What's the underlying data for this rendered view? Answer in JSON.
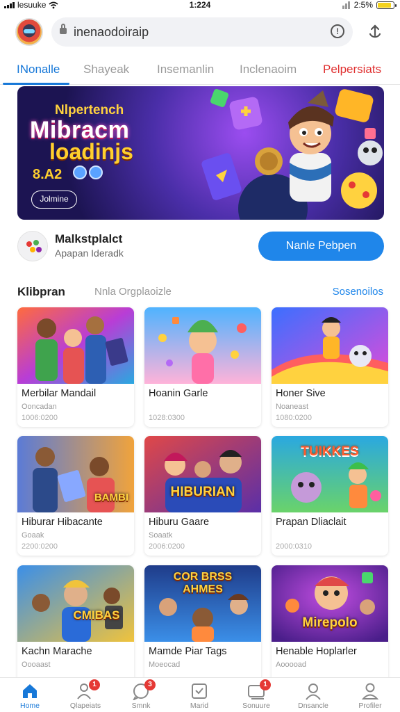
{
  "status_bar": {
    "carrier": "lesuuke",
    "time": "1:224",
    "battery": "2:5%",
    "battery_level": 0.9
  },
  "address_bar": {
    "url": "inenaodoiraip"
  },
  "tabs": [
    {
      "label": "INonalle",
      "active": true
    },
    {
      "label": "Shayeak",
      "active": false
    },
    {
      "label": "Insemanlin",
      "active": false
    },
    {
      "label": "Inclenaoim",
      "active": false
    },
    {
      "label": "Pelpersiats",
      "active": false
    }
  ],
  "banner": {
    "title_small": "Nlpertench",
    "title": "Mibracm",
    "subtitle": "loadinjs",
    "price": "8.A2",
    "button_label": "Jolmine"
  },
  "marketplace": {
    "title": "Malkstplalct",
    "subtitle": "Apapan Ideradk",
    "button_label": "Nanle Pebpen"
  },
  "section": {
    "title": "Klibpran",
    "subtitle": "Nnla Orgplaoizle",
    "link": "Sosenoilos"
  },
  "cards": [
    {
      "title": "Merbilar Mandail",
      "meta": "Ooncadan",
      "id": "1006:0200",
      "thumb_label": ""
    },
    {
      "title": "Hoanin Garle",
      "meta": "",
      "id": "1028:0300",
      "thumb_label": ""
    },
    {
      "title": "Honer Sive",
      "meta": "Noaneast",
      "id": "1080:0200",
      "thumb_label": ""
    },
    {
      "title": "Hiburar Hibacante",
      "meta": "Goaak",
      "id": "2200:0200",
      "thumb_label": "BAMBI"
    },
    {
      "title": "Hiburu Gaare",
      "meta": "Soaatk",
      "id": "2006:0200",
      "thumb_label": "HIBURIAN"
    },
    {
      "title": "Prapan Dliaclait",
      "meta": "",
      "id": "2000:0310",
      "thumb_label": "TUIKKES"
    },
    {
      "title": "Kachn Marache",
      "meta": "Oooaast",
      "id": "",
      "thumb_label": "CMIBAS"
    },
    {
      "title": "Mamde Piar Tags",
      "meta": "Moeocad",
      "id": "",
      "thumb_label": "COR BRSS AHMES"
    },
    {
      "title": "Henable Hoplarler",
      "meta": "Aooooad",
      "id": "",
      "thumb_label": "Mirepolo"
    }
  ],
  "bottom_nav": [
    {
      "label": "Home",
      "icon": "home-icon",
      "badge": "",
      "active": true
    },
    {
      "label": "Qlapeiats",
      "icon": "people-icon",
      "badge": "1",
      "active": false
    },
    {
      "label": "Smnk",
      "icon": "chat-icon",
      "badge": "3",
      "active": false
    },
    {
      "label": "Marid",
      "icon": "check-box-icon",
      "badge": "",
      "active": false
    },
    {
      "label": "Sonuure",
      "icon": "message-icon",
      "badge": "1",
      "active": false
    },
    {
      "label": "Dnsancle",
      "icon": "search-person-icon",
      "badge": "",
      "active": false
    },
    {
      "label": "Profiler",
      "icon": "profile-icon",
      "badge": "",
      "active": false
    }
  ],
  "colors": {
    "accent": "#1778d8",
    "button": "#1f86ea",
    "badge": "#e53935",
    "battery": "#f4d21d"
  }
}
